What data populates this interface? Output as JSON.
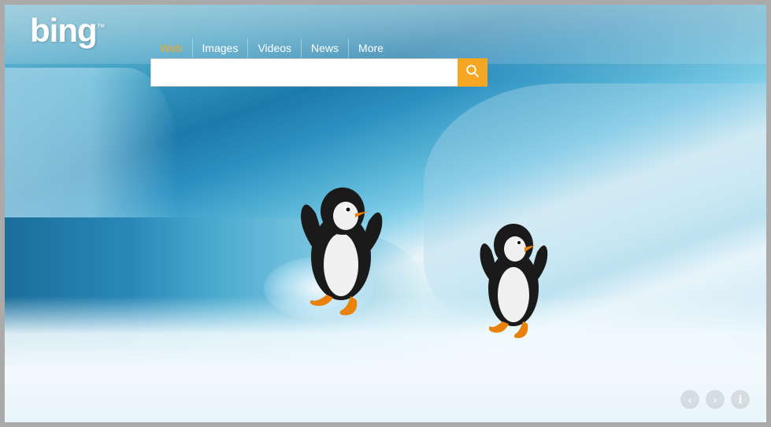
{
  "logo": {
    "text": "bing",
    "tm": "™"
  },
  "nav": {
    "links": [
      {
        "id": "web",
        "label": "Web",
        "active": true
      },
      {
        "id": "images",
        "label": "Images",
        "active": false
      },
      {
        "id": "videos",
        "label": "Videos",
        "active": false
      },
      {
        "id": "news",
        "label": "News",
        "active": false
      },
      {
        "id": "more",
        "label": "More",
        "active": false
      }
    ]
  },
  "search": {
    "placeholder": "",
    "button_icon": "🔍"
  },
  "bottom_nav": {
    "prev_icon": "‹",
    "next_icon": "›",
    "info_icon": "ℹ"
  },
  "colors": {
    "accent": "#f5a623",
    "nav_active": "#f5a623",
    "nav_inactive": "#ffffff"
  }
}
